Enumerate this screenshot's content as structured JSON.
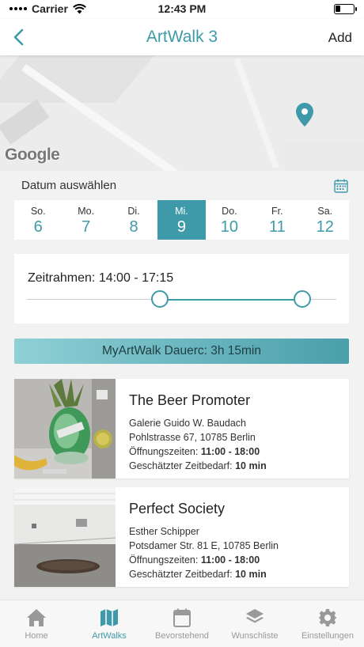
{
  "status_bar": {
    "carrier": "Carrier",
    "time": "12:43 PM"
  },
  "nav": {
    "title": "ArtWalk 3",
    "add_label": "Add"
  },
  "map": {
    "provider_logo": "Google"
  },
  "date_picker": {
    "label": "Datum auswählen",
    "days": [
      {
        "name": "So.",
        "date": "6",
        "selected": false
      },
      {
        "name": "Mo.",
        "date": "7",
        "selected": false
      },
      {
        "name": "Di.",
        "date": "8",
        "selected": false
      },
      {
        "name": "Mi.",
        "date": "9",
        "selected": true
      },
      {
        "name": "Do.",
        "date": "10",
        "selected": false
      },
      {
        "name": "Fr.",
        "date": "11",
        "selected": false
      },
      {
        "name": "Sa.",
        "date": "12",
        "selected": false
      }
    ]
  },
  "time_range": {
    "label": "Zeitrahmen: 14:00 - 17:15",
    "start_fraction": 0.43,
    "end_fraction": 0.89
  },
  "duration": {
    "text": "MyArtWalk Dauerc: 3h 15min"
  },
  "cards": [
    {
      "title": "The Beer Promoter",
      "gallery": "Galerie Guido W. Baudach",
      "address": "Pohlstrasse 67, 10785 Berlin",
      "hours_label": "Öffnungszeiten:",
      "hours": "11:00 - 18:00",
      "time_label": "Geschätzter Zeitbedarf:",
      "time": "10 min"
    },
    {
      "title": "Perfect Society",
      "gallery": "Esther Schipper",
      "address": "Potsdamer Str. 81 E, 10785 Berlin",
      "hours_label": "Öffnungszeiten:",
      "hours": "11:00 - 18:00",
      "time_label": "Geschätzter Zeitbedarf:",
      "time": "10 min"
    }
  ],
  "tabs": [
    {
      "label": "Home",
      "icon": "home-icon",
      "active": false
    },
    {
      "label": "ArtWalks",
      "icon": "map-icon",
      "active": true
    },
    {
      "label": "Bevorstehend",
      "icon": "calendar-icon",
      "active": false
    },
    {
      "label": "Wunschliste",
      "icon": "layers-icon",
      "active": false
    },
    {
      "label": "Einstellungen",
      "icon": "gear-icon",
      "active": false
    }
  ],
  "colors": {
    "accent": "#3e9aa8",
    "inactive": "#999999"
  }
}
